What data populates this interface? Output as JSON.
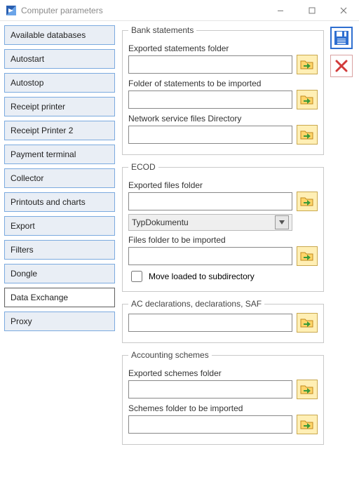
{
  "window": {
    "title": "Computer parameters"
  },
  "tabs": [
    "Available databases",
    "Autostart",
    "Autostop",
    "Receipt printer",
    "Receipt Printer 2",
    "Payment terminal",
    "Collector",
    "Printouts and charts",
    "Export",
    "Filters",
    "Dongle",
    "Data Exchange",
    "Proxy"
  ],
  "selected_tab_index": 11,
  "groups": {
    "bank": {
      "legend": "Bank statements",
      "exported_label": "Exported statements folder",
      "exported_value": "",
      "import_label": "Folder of statements to be imported",
      "import_value": "",
      "network_label": "Network service files Directory",
      "network_value": ""
    },
    "ecod": {
      "legend": "ECOD",
      "exported_label": "Exported files folder",
      "exported_value": "",
      "doc_type_selected": "TypDokumentu",
      "import_label": "Files folder to be imported",
      "import_value": "",
      "move_loaded_label": "Move loaded to subdirectory",
      "move_loaded_checked": false
    },
    "ac": {
      "legend": "AC declarations, declarations, SAF",
      "value": ""
    },
    "schemes": {
      "legend": "Accounting schemes",
      "exported_label": "Exported schemes folder",
      "exported_value": "",
      "import_label": "Schemes folder to be imported",
      "import_value": ""
    }
  }
}
